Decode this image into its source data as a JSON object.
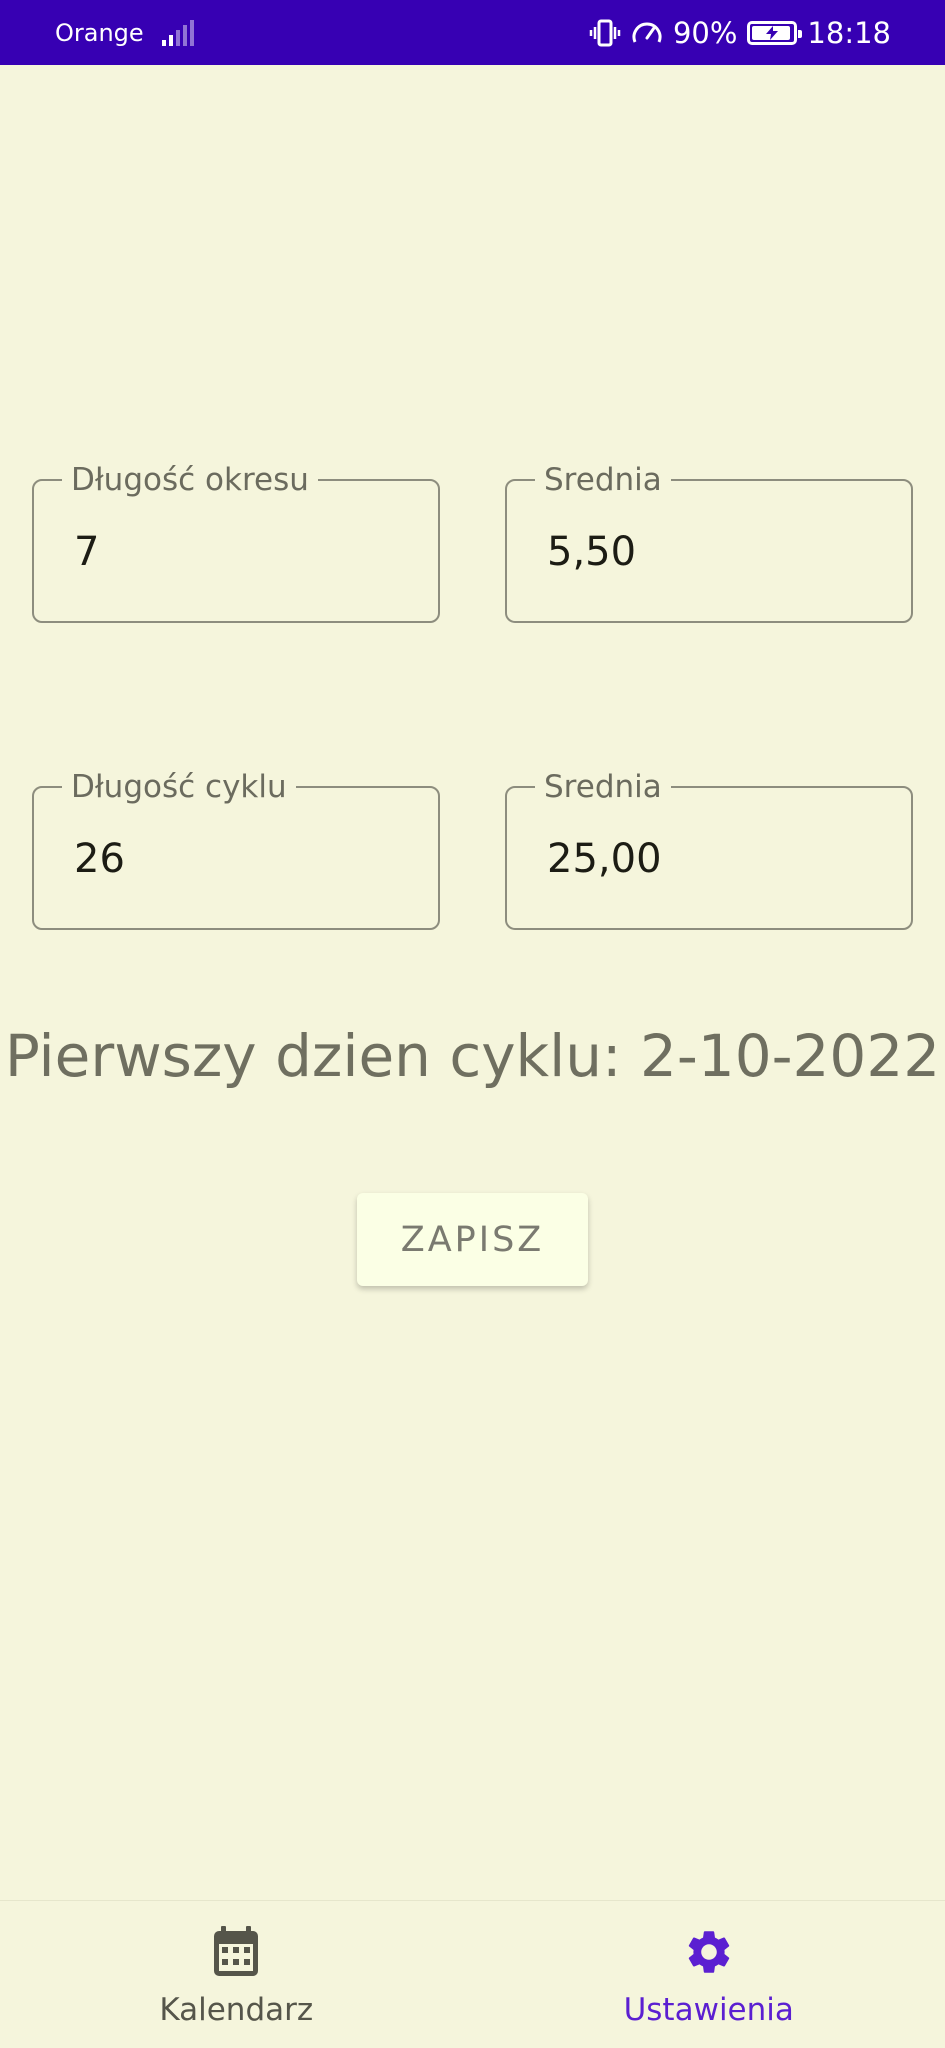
{
  "status_bar": {
    "carrier": "Orange",
    "battery_percent": "90%",
    "time": "18:18",
    "icons": [
      "signal-icon",
      "vibrate-icon",
      "speed-icon",
      "battery-charging-icon"
    ]
  },
  "fields": {
    "period_length": {
      "label": "Długość okresu",
      "value": "7"
    },
    "period_average": {
      "label": "Srednia",
      "value": "5,50"
    },
    "cycle_length": {
      "label": "Długość cyklu",
      "value": "26"
    },
    "cycle_average": {
      "label": "Srednia",
      "value": "25,00"
    }
  },
  "first_day_text": "Pierwszy dzien cyklu: 2-10-2022",
  "save_label": "ZAPISZ",
  "nav": {
    "calendar_label": "Kalendarz",
    "settings_label": "Ustawienia",
    "active": "settings"
  },
  "colors": {
    "status_bar": "#3700B3",
    "background": "#F5F5DC",
    "active_nav": "#5b1fd1",
    "inactive_nav": "#55554a"
  }
}
